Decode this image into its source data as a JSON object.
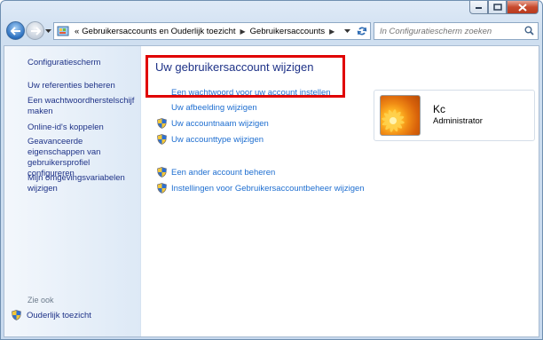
{
  "window": {
    "caption_buttons": {
      "minimize": "minimize-icon",
      "maximize": "maximize-icon",
      "close": "close-icon"
    }
  },
  "navigation": {
    "back_icon": "back-arrow-icon",
    "forward_icon": "forward-arrow-icon",
    "address": {
      "overflow": "«",
      "crumbs": [
        "Gebruikersaccounts en Ouderlijk toezicht",
        "Gebruikersaccounts"
      ]
    },
    "search": {
      "placeholder": "In Configuratiescherm zoeken"
    }
  },
  "sidebar": {
    "home_link": "Configuratiescherm",
    "links": [
      "Uw referenties beheren",
      "Een wachtwoordherstelschijf maken",
      "Online-id's koppelen",
      "Geavanceerde eigenschappen van gebruikersprofiel configureren",
      "Mijn omgevingsvariabelen wijzigen"
    ],
    "see_also_label": "Zie ook",
    "see_also_link": "Ouderlijk toezicht"
  },
  "main": {
    "heading": "Uw gebruikersaccount wijzigen",
    "links": [
      {
        "label": "Een wachtwoord voor uw account instellen",
        "shield": false
      },
      {
        "label": "Uw afbeelding wijzigen",
        "shield": false
      },
      {
        "label": "Uw accountnaam wijzigen",
        "shield": true
      },
      {
        "label": "Uw accounttype wijzigen",
        "shield": true
      }
    ],
    "other_links": [
      {
        "label": "Een ander account beheren",
        "shield": true
      },
      {
        "label": "Instellingen voor Gebruikersaccountbeheer wijzigen",
        "shield": true
      }
    ],
    "highlight_color": "#e00000"
  },
  "user": {
    "name": "Kc",
    "role": "Administrator"
  }
}
